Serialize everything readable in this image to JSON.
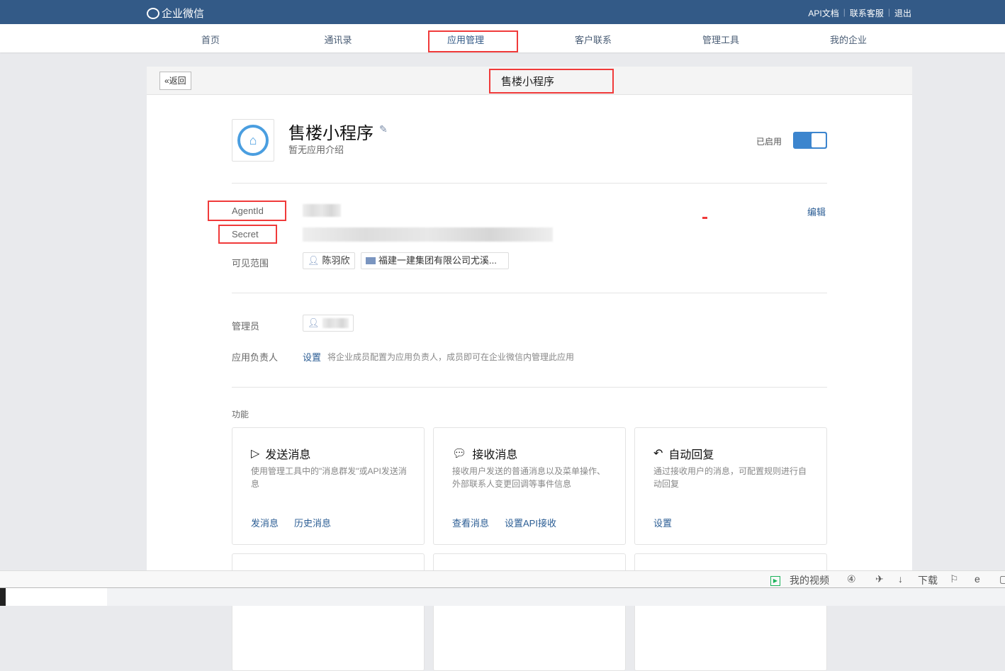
{
  "topbar": {
    "logo": "企业微信",
    "links": [
      "API文档",
      "联系客服",
      "退出"
    ]
  },
  "nav": {
    "items": [
      "首页",
      "通讯录",
      "应用管理",
      "客户联系",
      "管理工具",
      "我的企业"
    ],
    "active": 2
  },
  "card": {
    "back": "«返回",
    "title": "售楼小程序"
  },
  "app": {
    "name": "售楼小程序",
    "desc": "暂无应用介绍",
    "status": "已启用",
    "enabled": true
  },
  "info": {
    "agentid_label": "AgentId",
    "secret_label": "Secret",
    "edit": "编辑",
    "scope_label": "可见范围",
    "scope_tags": [
      "陈羽欣",
      "福建一建集团有限公司尤溪..."
    ]
  },
  "admin": {
    "label": "管理员",
    "owner_label": "应用负责人",
    "owner_link": "设置",
    "owner_hint": "将企业成员配置为应用负责人，成员即可在企业微信内管理此应用"
  },
  "features": {
    "label": "功能",
    "cards": [
      {
        "title": "发送消息",
        "icon": "send-icon",
        "desc": "使用管理工具中的\"消息群发\"或API发送消息",
        "actions": [
          "发消息",
          "历史消息"
        ]
      },
      {
        "title": "接收消息",
        "icon": "message-icon",
        "desc": "接收用户发送的普通消息以及菜单操作、外部联系人变更回调等事件信息",
        "actions": [
          "查看消息",
          "设置API接收"
        ]
      },
      {
        "title": "自动回复",
        "icon": "reply-icon",
        "desc": "通过接收用户的消息，可配置规则进行自动回复",
        "actions": [
          "设置"
        ]
      }
    ]
  },
  "browser": {
    "video": "我的视频",
    "download": "下载"
  },
  "colors": {
    "topbar": "#335a87",
    "accent": "#3c85ce",
    "annotation": "#f03a3a"
  }
}
